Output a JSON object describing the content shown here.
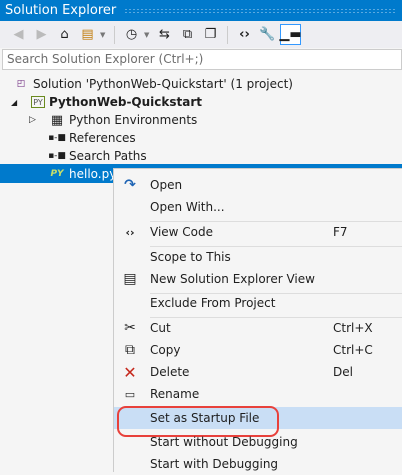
{
  "title": "Solution Explorer",
  "toolbar": {
    "icons": [
      "back-icon",
      "forward-icon",
      "home-icon",
      "switch-views-icon",
      "pending-changes-filter-icon",
      "sync-icon",
      "collapse-all-icon",
      "show-all-files-icon",
      "view-code-icon",
      "properties-icon",
      "preview-icon"
    ]
  },
  "search": {
    "placeholder": "Search Solution Explorer (Ctrl+;)"
  },
  "tree": {
    "solution": "Solution 'PythonWeb-Quickstart' (1 project)",
    "project": "PythonWeb-Quickstart",
    "items": [
      "Python Environments",
      "References",
      "Search Paths"
    ],
    "selected": "hello.py",
    "project_badge": "PY"
  },
  "menu": {
    "items": [
      {
        "label": "Open",
        "shortcut": ""
      },
      {
        "label": "Open With...",
        "shortcut": ""
      },
      {
        "label": "View Code",
        "shortcut": "F7"
      },
      {
        "label": "Scope to This",
        "shortcut": ""
      },
      {
        "label": "New Solution Explorer View",
        "shortcut": ""
      },
      {
        "label": "Exclude From Project",
        "shortcut": ""
      },
      {
        "label": "Cut",
        "shortcut": "Ctrl+X"
      },
      {
        "label": "Copy",
        "shortcut": "Ctrl+C"
      },
      {
        "label": "Delete",
        "shortcut": "Del"
      },
      {
        "label": "Rename",
        "shortcut": ""
      },
      {
        "label": "Set as Startup File",
        "shortcut": ""
      },
      {
        "label": "Start without Debugging",
        "shortcut": ""
      },
      {
        "label": "Start with Debugging",
        "shortcut": ""
      }
    ],
    "highlighted": "Set as Startup File"
  },
  "colors": {
    "accent": "#007acc",
    "highlight": "#c9def5",
    "callout": "#e8413b"
  }
}
